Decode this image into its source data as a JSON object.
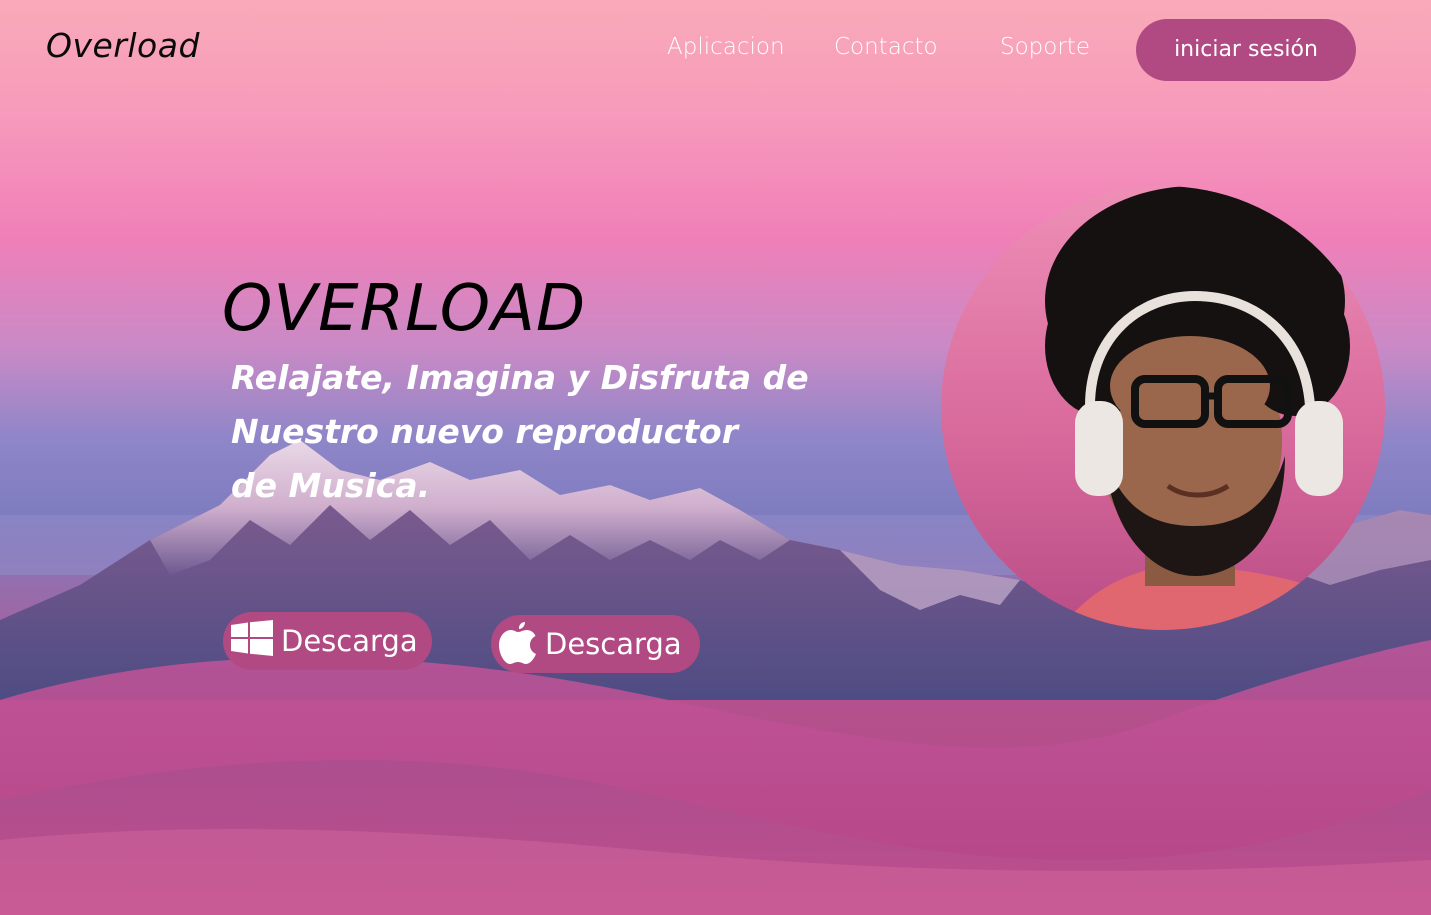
{
  "nav": {
    "brand": "Overload",
    "links": [
      {
        "label": "Aplicacion"
      },
      {
        "label": "Contacto"
      },
      {
        "label": "Soporte"
      }
    ],
    "login_label": "iniciar sesión"
  },
  "hero": {
    "title": "OVERLOAD",
    "subtitle_lines": [
      "Relajate, Imagina y Disfruta de",
      "Nuestro nuevo reproductor",
      "de Musica."
    ],
    "downloads": [
      {
        "label": "Descarga",
        "icon": "windows-icon"
      },
      {
        "label": "Descarga",
        "icon": "apple-icon"
      }
    ]
  },
  "colors": {
    "accent": "#b14a83",
    "sky_top": "#f9aab9",
    "sky_mid": "#f07fb8",
    "haze": "#8e86c8"
  }
}
